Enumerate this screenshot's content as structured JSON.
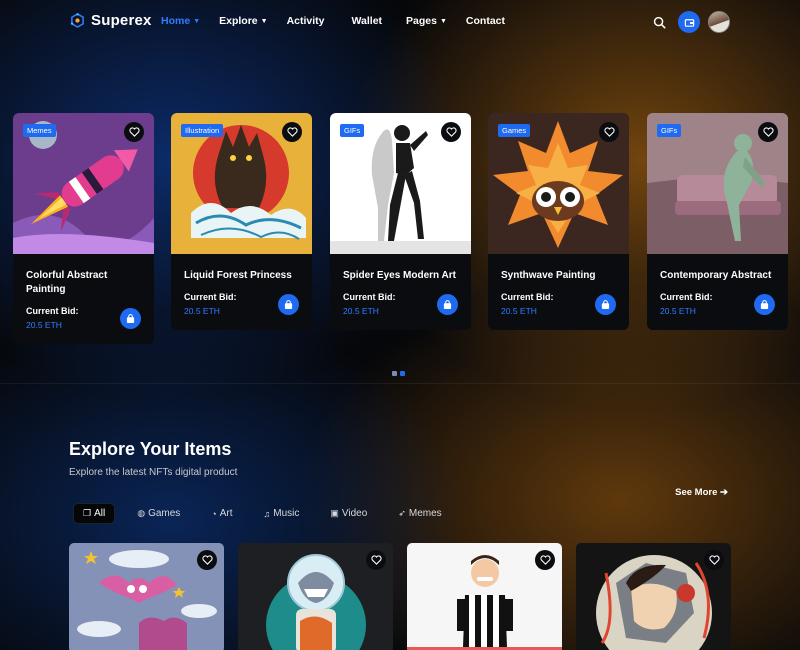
{
  "brand": {
    "name": "Superex"
  },
  "nav": [
    {
      "label": "Home",
      "active": true,
      "dropdown": true
    },
    {
      "label": "Explore",
      "active": false,
      "dropdown": true
    },
    {
      "label": "Activity",
      "active": false,
      "dropdown": false
    },
    {
      "label": "Wallet",
      "active": false,
      "dropdown": false
    },
    {
      "label": "Pages",
      "active": false,
      "dropdown": true
    },
    {
      "label": "Contact",
      "active": false,
      "dropdown": false
    }
  ],
  "header_icons": [
    "search-icon",
    "wallet-icon",
    "avatar"
  ],
  "carousel": {
    "cards": [
      {
        "tag": "Memes",
        "title": "Colorful Abstract Painting",
        "bid_label": "Current Bid:",
        "price": "20.5 ETH"
      },
      {
        "tag": "Illustration",
        "title": "Liquid Forest Princess",
        "bid_label": "Current Bid:",
        "price": "20.5 ETH"
      },
      {
        "tag": "GIFs",
        "title": "Spider Eyes Modern Art",
        "bid_label": "Current Bid:",
        "price": "20.5 ETH"
      },
      {
        "tag": "Games",
        "title": "Synthwave Painting",
        "bid_label": "Current Bid:",
        "price": "20.5 ETH"
      },
      {
        "tag": "GIFs",
        "title": "Contemporary Abstract",
        "bid_label": "Current Bid:",
        "price": "20.5 ETH"
      }
    ],
    "pagination": {
      "pages": 2,
      "active": 2
    }
  },
  "explore": {
    "title": "Explore Your Items",
    "subtitle": "Explore the latest NFTs digital product",
    "see_more": "See More",
    "filters": [
      {
        "label": "All",
        "icon": "layers-icon",
        "active": true
      },
      {
        "label": "Games",
        "icon": "gamepad-icon",
        "active": false
      },
      {
        "label": "Art",
        "icon": "palette-icon",
        "active": false
      },
      {
        "label": "Music",
        "icon": "music-icon",
        "active": false
      },
      {
        "label": "Video",
        "icon": "video-icon",
        "active": false
      },
      {
        "label": "Memes",
        "icon": "rocket-icon",
        "active": false
      }
    ]
  },
  "colors": {
    "accent": "#1e6af0",
    "price": "#2f7dff",
    "card_bg": "#0b0c10"
  }
}
